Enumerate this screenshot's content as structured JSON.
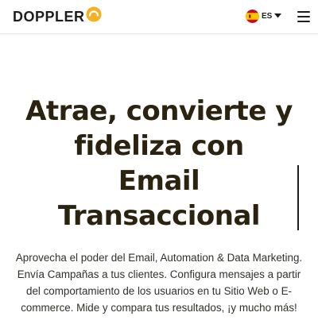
{
  "header": {
    "logo_text": "DOPPLER",
    "language": {
      "code": "ES",
      "flag": "spain-flag-icon"
    },
    "menu_icon": "hamburger-menu-icon"
  },
  "colors": {
    "brand_accent": "#f6b024",
    "title_color": "#2b2310",
    "text_color": "#33302a"
  },
  "hero": {
    "title_lines": [
      "Atrae, convierte y",
      "fideliza con",
      "Email",
      "Transaccional"
    ],
    "description": "Aprovecha el poder del Email, Automation & Data Marketing. Envía Campañas a tus clientes. Configura mensajes a partir del comportamiento de los usuarios en tu Sitio Web o E-commerce. Mide y compara tus resultados, ¡y mucho más!"
  }
}
